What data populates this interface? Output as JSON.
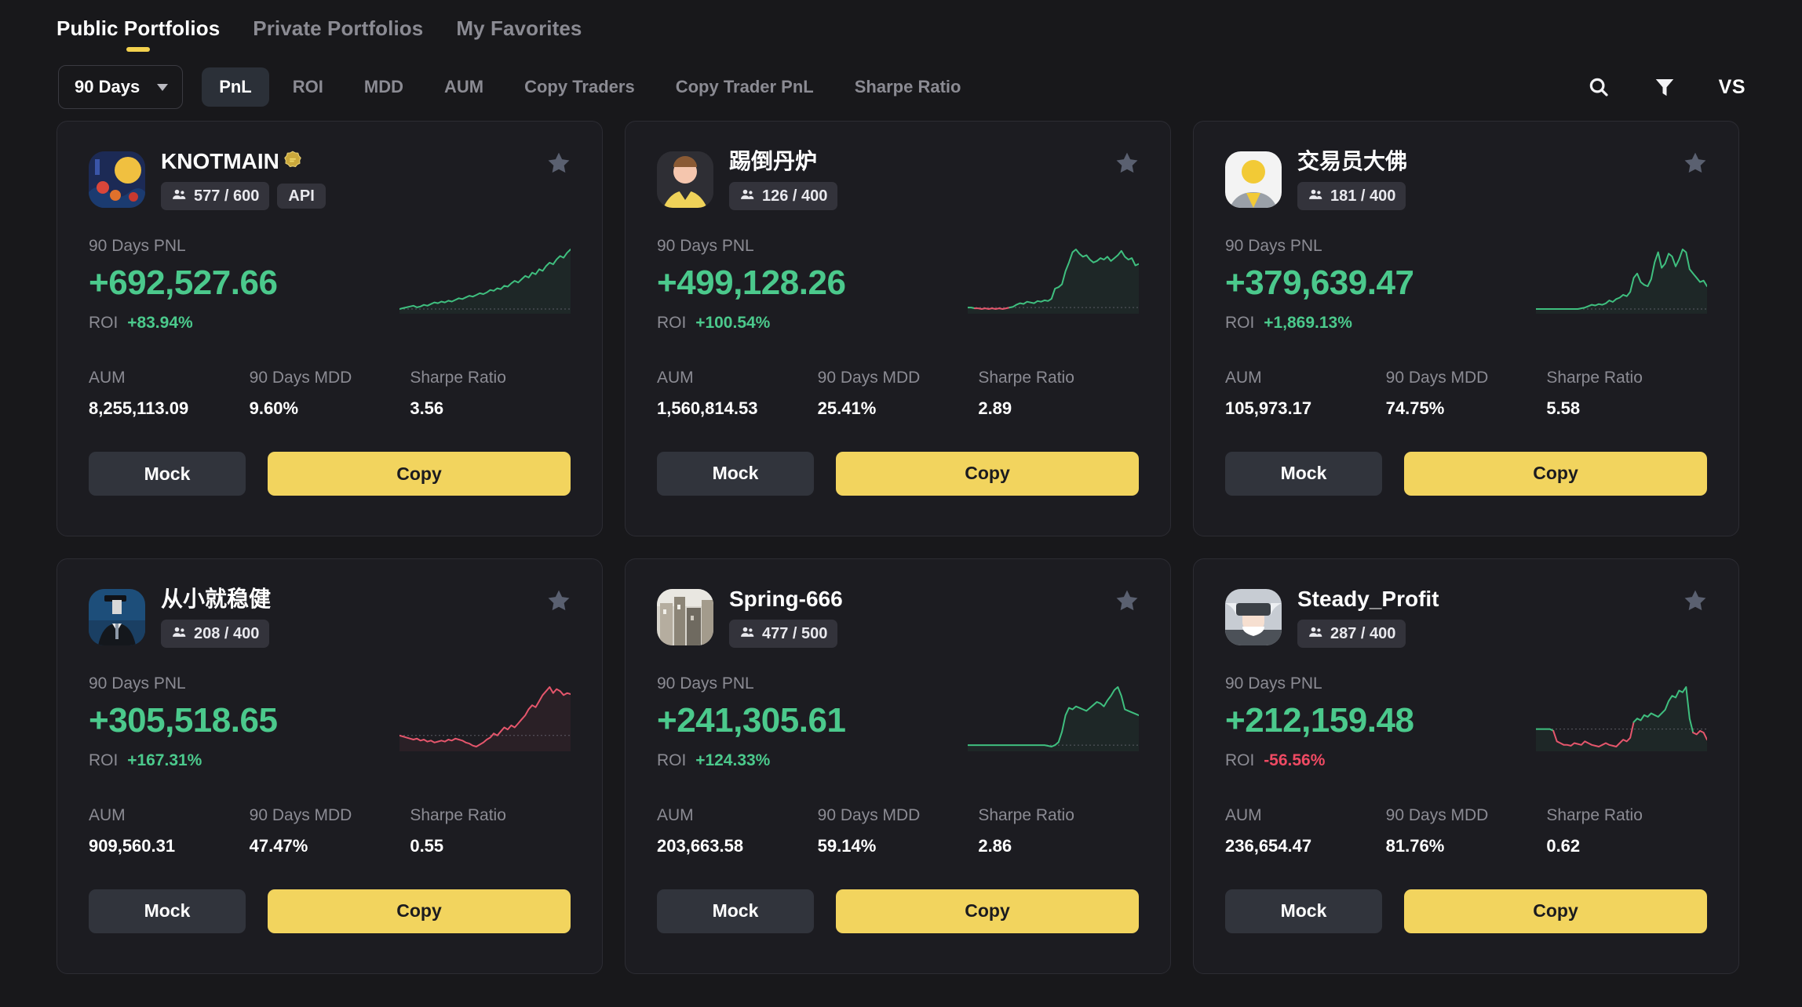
{
  "tabs": [
    {
      "label": "Public Portfolios",
      "active": true
    },
    {
      "label": "Private Portfolios",
      "active": false
    },
    {
      "label": "My Favorites",
      "active": false
    }
  ],
  "filter_bar": {
    "range_value": "90 Days",
    "metrics": [
      {
        "label": "PnL",
        "active": true
      },
      {
        "label": "ROI",
        "active": false
      },
      {
        "label": "MDD",
        "active": false
      },
      {
        "label": "AUM",
        "active": false
      },
      {
        "label": "Copy Traders",
        "active": false
      },
      {
        "label": "Copy Trader PnL",
        "active": false
      },
      {
        "label": "Sharpe Ratio",
        "active": false
      }
    ],
    "search_icon": "search-icon",
    "filter_icon": "funnel-icon",
    "vs_label": "VS"
  },
  "labels": {
    "pnl_label": "90 Days PNL",
    "roi_label": "ROI",
    "aum_label": "AUM",
    "mdd_label": "90 Days MDD",
    "sharpe_label": "Sharpe Ratio",
    "mock_label": "Mock",
    "copy_label": "Copy"
  },
  "colors": {
    "accent": "#f2d45e",
    "positive": "#4bc98c",
    "negative": "#ef4a63",
    "page_bg": "#18181b",
    "card_bg": "#1c1c21"
  },
  "cards": [
    {
      "name": "KNOTMAIN",
      "verified_badge": true,
      "copiers": "577 / 600",
      "api_tag": "API",
      "pnl": "+692,527.66",
      "pnl_sign": "pos",
      "roi": "+83.94%",
      "roi_sign": "pos",
      "aum": "8,255,113.09",
      "mdd": "9.60%",
      "sharpe": "3.56",
      "avatar_style": "art-orange",
      "chart": {
        "type": "line",
        "line_color": "#3fbf7f",
        "values": [
          18,
          19,
          20,
          21,
          22,
          20,
          21,
          23,
          22,
          24,
          26,
          25,
          27,
          26,
          28,
          27,
          29,
          31,
          30,
          32,
          34,
          33,
          35,
          37,
          36,
          38,
          41,
          40,
          43,
          42,
          46,
          45,
          49,
          52,
          50,
          54,
          58,
          56,
          62,
          60,
          66,
          64,
          70,
          74,
          72,
          78,
          82,
          80,
          86,
          90
        ]
      }
    },
    {
      "name": "踢倒丹炉",
      "verified_badge": false,
      "copiers": "126 / 400",
      "api_tag": null,
      "pnl": "+499,128.26",
      "pnl_sign": "pos",
      "roi": "+100.54%",
      "roi_sign": "pos",
      "aum": "1,560,814.53",
      "mdd": "25.41%",
      "sharpe": "2.89",
      "avatar_style": "person-yellow",
      "chart": {
        "type": "line",
        "line_color": "#3fbf7f",
        "neg_color": "#e5566c",
        "values": [
          8,
          8,
          7,
          7,
          6,
          7,
          6,
          7,
          6,
          7,
          6,
          7,
          8,
          9,
          12,
          14,
          13,
          16,
          15,
          14,
          17,
          16,
          18,
          17,
          20,
          34,
          36,
          40,
          58,
          70,
          84,
          88,
          82,
          78,
          80,
          74,
          70,
          72,
          76,
          74,
          78,
          72,
          76,
          80,
          86,
          78,
          74,
          76,
          66,
          68
        ]
      }
    },
    {
      "name": "交易员大佛",
      "verified_badge": false,
      "copiers": "181 / 400",
      "api_tag": null,
      "pnl": "+379,639.47",
      "pnl_sign": "pos",
      "roi": "+1,869.13%",
      "roi_sign": "pos",
      "aum": "105,973.17",
      "mdd": "74.75%",
      "sharpe": "5.58",
      "avatar_style": "person-white",
      "chart": {
        "type": "line",
        "line_color": "#3fbf7f",
        "values": [
          6,
          6,
          6,
          6,
          6,
          6,
          6,
          6,
          6,
          6,
          6,
          6,
          6,
          7,
          8,
          10,
          12,
          11,
          13,
          12,
          14,
          18,
          16,
          20,
          22,
          26,
          24,
          30,
          50,
          56,
          44,
          40,
          38,
          48,
          72,
          86,
          64,
          70,
          84,
          80,
          66,
          76,
          90,
          86,
          62,
          56,
          50,
          44,
          46,
          38
        ]
      }
    },
    {
      "name": "从小就稳健",
      "verified_badge": false,
      "copiers": "208 / 400",
      "api_tag": null,
      "pnl": "+305,518.65",
      "pnl_sign": "pos",
      "roi": "+167.31%",
      "roi_sign": "pos",
      "aum": "909,560.31",
      "mdd": "47.47%",
      "sharpe": "0.55",
      "avatar_style": "suit-blue",
      "chart": {
        "type": "line",
        "line_color": "#e5566c",
        "baseline_top": true,
        "values": [
          30,
          29,
          28,
          27,
          26,
          27,
          25,
          26,
          24,
          25,
          23,
          24,
          25,
          24,
          26,
          25,
          27,
          26,
          25,
          23,
          22,
          20,
          19,
          21,
          23,
          26,
          28,
          32,
          30,
          34,
          38,
          36,
          40,
          38,
          42,
          46,
          50,
          56,
          60,
          58,
          64,
          70,
          74,
          78,
          72,
          76,
          74,
          70,
          72,
          71
        ]
      }
    },
    {
      "name": "Spring-666",
      "verified_badge": false,
      "copiers": "477 / 500",
      "api_tag": null,
      "pnl": "+241,305.61",
      "pnl_sign": "pos",
      "roi": "+124.33%",
      "roi_sign": "pos",
      "aum": "203,663.58",
      "mdd": "59.14%",
      "sharpe": "2.86",
      "avatar_style": "city-photo",
      "chart": {
        "type": "line",
        "line_color": "#3fbf7f",
        "values": [
          12,
          12,
          12,
          12,
          12,
          12,
          12,
          12,
          12,
          12,
          12,
          12,
          12,
          12,
          12,
          12,
          12,
          12,
          12,
          12,
          12,
          12,
          12,
          11,
          10,
          12,
          16,
          30,
          52,
          62,
          60,
          64,
          62,
          60,
          58,
          62,
          66,
          70,
          68,
          64,
          72,
          78,
          86,
          90,
          78,
          60,
          58,
          56,
          54,
          52
        ]
      }
    },
    {
      "name": "Steady_Profit",
      "verified_badge": false,
      "copiers": "287 / 400",
      "api_tag": null,
      "pnl": "+212,159.48",
      "pnl_sign": "pos",
      "roi": "-56.56%",
      "roi_sign": "neg",
      "aum": "236,654.47",
      "mdd": "81.76%",
      "sharpe": "0.62",
      "avatar_style": "mask-gray",
      "chart": {
        "type": "line",
        "line_color": "#3fbf7f",
        "neg_color": "#e5566c",
        "values": [
          40,
          40,
          40,
          40,
          40,
          38,
          26,
          24,
          22,
          22,
          21,
          24,
          23,
          22,
          26,
          24,
          22,
          21,
          20,
          22,
          24,
          22,
          21,
          20,
          24,
          28,
          26,
          30,
          48,
          52,
          50,
          56,
          54,
          58,
          56,
          54,
          58,
          62,
          72,
          78,
          76,
          84,
          82,
          88,
          52,
          36,
          34,
          38,
          36,
          28
        ]
      }
    }
  ]
}
